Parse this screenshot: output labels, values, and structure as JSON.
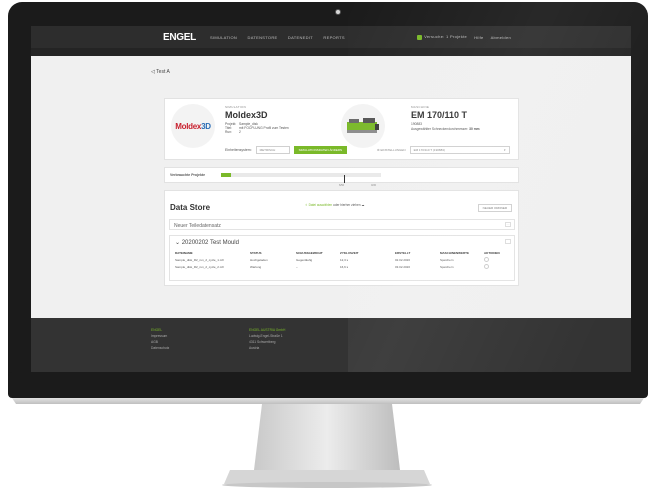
{
  "topbar": {
    "logo": "ENGEL",
    "nav": [
      "SIMULATION",
      "DATENSTORE",
      "DATENEDIT",
      "REPORTS"
    ],
    "right": [
      "Versuche: 1 Projekte",
      "Hilfe",
      "Abmelden"
    ]
  },
  "breadcrumb": "Test A",
  "simulation": {
    "section_label": "SIMULATION",
    "logo_text_a": "Moldex",
    "logo_text_b": "3D",
    "name": "Moldex3D",
    "meta_labels": [
      "Projekt:",
      "Titel:",
      "Run:"
    ],
    "meta_values": [
      "Sample_disk",
      "mit FOCPLUNG Profil zum Testen",
      "2"
    ],
    "einheit_label": "Einheitensystem:",
    "einheit_value": "METRISCH",
    "green_button": "SIMULATIONSDATEN ÄNDERN"
  },
  "machine": {
    "section_label": "MASCHINE",
    "name": "EM 170/110 T",
    "code": "190883",
    "screw_label": "Ausgewählter Schneckendurchmesser:",
    "screw_value": "30 mm",
    "select_label": "EINSTELLUNGEN",
    "select_value": "EM 170/110 T (190883)"
  },
  "usage": {
    "label": "Verbrauchte Projekte",
    "fill_percent": 0.06,
    "tick_a": "6/50",
    "tick_b": "0/30"
  },
  "datastore": {
    "title": "Data Store",
    "upload_link": "Datei auswählen",
    "upload_rest": "oder hierher ziehen",
    "folder_button": "NEUER ORDNER",
    "new_dataset": "Neuer Teiledatensatz",
    "table_title": "20200202 Test Mould",
    "headers": [
      "DATEINAME",
      "STATUS",
      "SCHUSSGEWICHT",
      "ZYKLUSZEIT",
      "ERSTELLT",
      "MASCHINENWERTE",
      "AKTIONEN"
    ],
    "rows": [
      [
        "Sample_disk_R2_run_2_cycle_1.mfr",
        "Hochgeladen",
        "Gegenläufig",
        "12,3 s",
        "02.02.2020",
        "Speichern",
        ""
      ],
      [
        "Sample_disk_R2_run_2_cycle_2.mfr",
        "Wartung",
        "–",
        "16,6 s",
        "03.02.2020",
        "Speichern",
        ""
      ]
    ]
  },
  "footer": {
    "col1": [
      "ENGEL",
      "Impressum",
      "AGB",
      "Datenschutz"
    ],
    "col2": [
      "ENGEL AUSTRIA GmbH",
      "Ludwig-Engel-Straße 1",
      "4311 Schwertberg",
      "Austria"
    ]
  }
}
